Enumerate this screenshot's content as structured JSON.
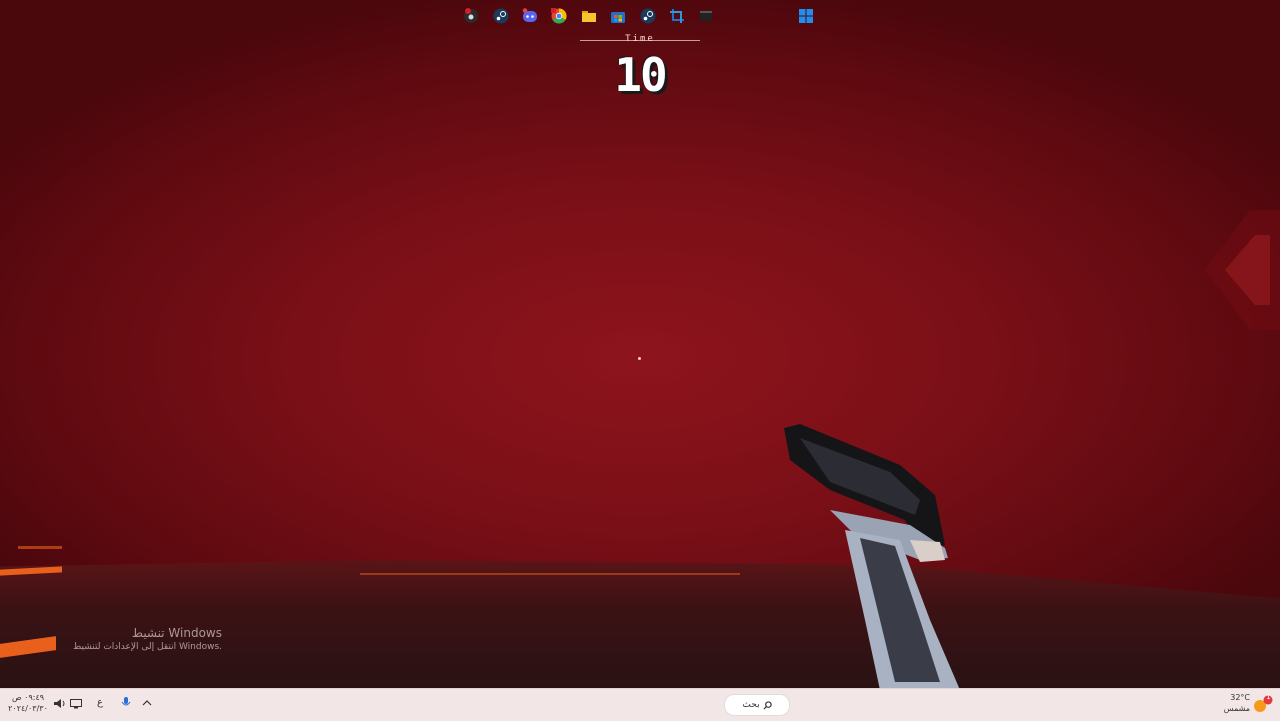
{
  "hud": {
    "timer_label": "Time",
    "timer_value": "10"
  },
  "windows_activation": {
    "title": "تنشيط Windows",
    "subtitle": "انتقل إلى الإعدادات لتنشيط Windows."
  },
  "taskbar": {
    "search_label": "بحث",
    "clock_time": "٠٩:٤٩ ص",
    "clock_date": "٢٠٢٤/٠٣/٣٠",
    "language": "ع",
    "weather_temp": "32°C",
    "weather_desc": "مشمس",
    "notification_count": "1",
    "apps": [
      "obs-icon",
      "steam-icon",
      "discord-icon",
      "chrome-icon",
      "file-explorer-icon",
      "store-icon",
      "steam-icon",
      "snipping-tool-icon",
      "terminal-icon",
      "windows-start-icon"
    ]
  },
  "colors": {
    "fog": "#8e141c",
    "lava": "#e8601c",
    "taskbar": "#f3e6e6"
  }
}
